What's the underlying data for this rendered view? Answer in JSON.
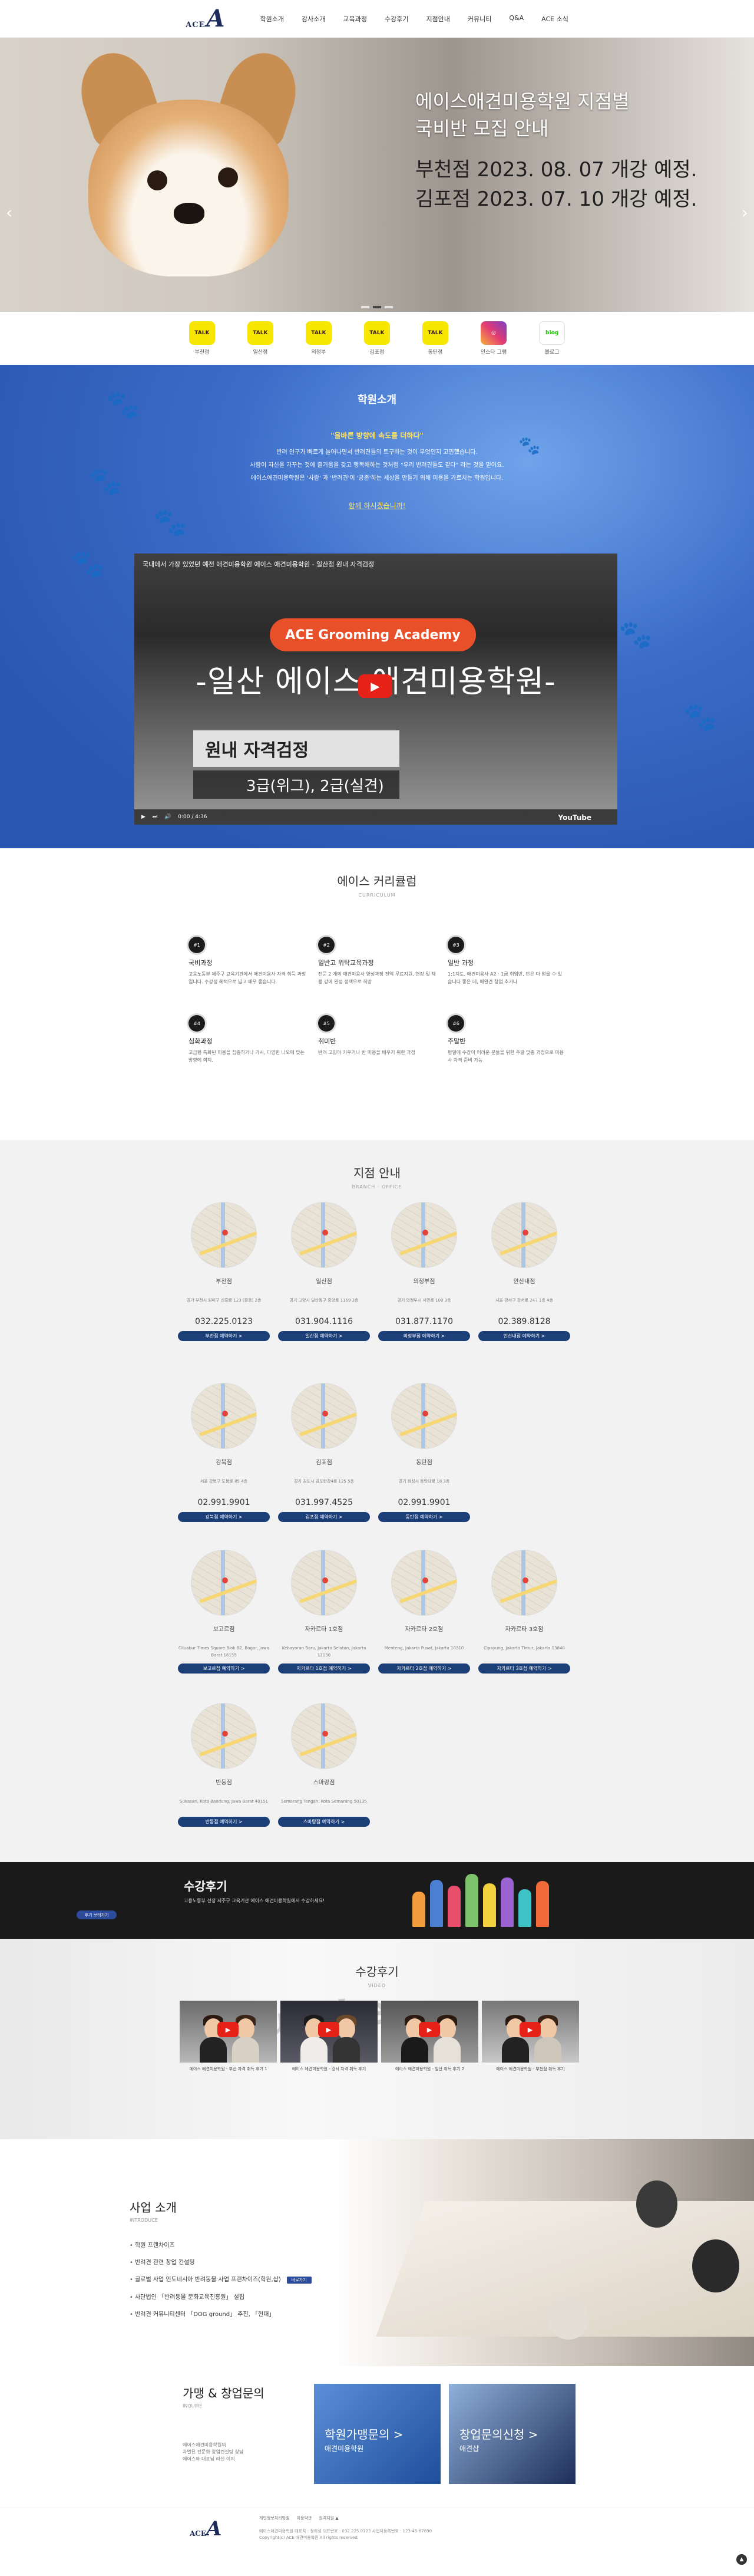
{
  "header": {
    "logo_small": "ACE",
    "logo_big": "A",
    "nav": [
      "학원소개",
      "강사소개",
      "교육과정",
      "수강후기",
      "지점안내",
      "커뮤니티",
      "Q&A",
      "ACE 소식"
    ]
  },
  "hero": {
    "line1": "에이스애견미용학원 지점별",
    "line2": "국비반 모집 안내",
    "line3": "부천점 2023. 08. 07 개강 예정.",
    "line4": "김포점 2023. 07. 10 개강 예정.",
    "prev": "‹",
    "next": "›"
  },
  "sns": [
    {
      "icon": "talk-icon",
      "badge": "TALK",
      "label": "부천점"
    },
    {
      "icon": "talk-icon",
      "badge": "TALK",
      "label": "일산점"
    },
    {
      "icon": "talk-icon",
      "badge": "TALK",
      "label": "의정부"
    },
    {
      "icon": "talk-icon",
      "badge": "TALK",
      "label": "김포점"
    },
    {
      "icon": "talk-icon",
      "badge": "TALK",
      "label": "동탄점"
    },
    {
      "icon": "instagram-icon",
      "badge": "◎",
      "label": "인스타 그램"
    },
    {
      "icon": "blog-icon",
      "badge": "blog",
      "label": "블로그"
    }
  ],
  "intro": {
    "title": "학원소개",
    "highlight": "\"올바른 방향에 속도를 더하다\"",
    "p1": "반려 인구가 빠르게 늘어나면서 반려견들의 트구하는 것이 무엇인지 고민했습니다.",
    "p2": "사람이 자신을 가꾸는 것에 즐거움을 갖고 행복해하는 것처럼 \"우리 반려견들도 같다\" 라는 것을 믿어요.",
    "p3": "에이스애견미용학원은 '사람' 과 '반려견'이 '공존'하는 세상을 만들기 위해 미용을 가르치는 학원입니다.",
    "link": "함께 하시겠습니까!",
    "video": {
      "title": "국내에서 가장 있었던 예전 애견미용학원 에이스 애견미용학원 - 일산점 원내 자격검정",
      "pill": "ACE Grooming Academy",
      "big": "-일산 에이스 애견미용학원-",
      "sub1": "원내 자격검정",
      "sub2": "3급(위그), 2급(실견)",
      "time": "0:00 / 4:36",
      "yt": "YouTube"
    }
  },
  "curriculum": {
    "title": "에이스 커리큘럼",
    "sub": "CURRICULUM",
    "items": [
      {
        "no": "#1",
        "title": "국비과정",
        "desc": "고용노동부 제주구 교육기관에서 애견미용사 자격 취득 과정입니다. 수강생 혜택으로 넘고 매우 좋습니다."
      },
      {
        "no": "#2",
        "title": "일반고 위탁교육과정",
        "desc": "전문 2 개의 애견미용사 양성과정 전액 무료지원, 현장 및 채용 강에 완성 정책으로 희망"
      },
      {
        "no": "#3",
        "title": "일반 과정",
        "desc": "1:1지도, 애견미용사 A2 · 1급 취업반, 반은 다 얻을 수 있습니다 좋은 데, 애완견 창업 추가나"
      },
      {
        "no": "#4",
        "title": "심화과정",
        "desc": "고급형 특화된 미용을 집중하거나 가시, 다양한 나오에 맞는 방향에 의지."
      },
      {
        "no": "#5",
        "title": "취미반",
        "desc": "반려 고양이 키우거나 반 미용을 배우기 위한 과정"
      },
      {
        "no": "#6",
        "title": "주말반",
        "desc": "평일에 수강이 어려운 분들을 위한 주말 맞춤 과정으로 미용사 자격 준비 가능"
      }
    ]
  },
  "branch": {
    "title": "지점 안내",
    "sub": "BRANCH · OFFICE",
    "items": [
      {
        "name": "부천점",
        "addr": "경기 부천시 원미구 신흥로 123 (중동) 2층",
        "tel": "032.225.0123",
        "btn": "부천점 예약하기 >"
      },
      {
        "name": "일산점",
        "addr": "경기 고양시 일산동구 중앙로 1169 3층",
        "tel": "031.904.1116",
        "btn": "일산점 예약하기 >"
      },
      {
        "name": "의정부점",
        "addr": "경기 의정부시 시민로 100 3층",
        "tel": "031.877.1170",
        "btn": "의정부점 예약하기 >"
      },
      {
        "name": "안산내점",
        "addr": "서울 강서구 강서로 247 1층 4층",
        "tel": "02.389.8128",
        "btn": "안산내점 예약하기 >"
      },
      {
        "name": "강북점",
        "addr": "서울 강북구 도봉로 85 4층",
        "tel": "02.991.9901",
        "btn": "강북점 예약하기 >"
      },
      {
        "name": "김포점",
        "addr": "경기 김포시 김포한강4로 125 5층",
        "tel": "031.997.4525",
        "btn": "김포점 예약하기 >"
      },
      {
        "name": "동탄점",
        "addr": "경기 화성시 동탄대로 18 3층",
        "tel": "02.991.9901",
        "btn": "동탄점 예약하기 >"
      },
      {
        "name": "",
        "addr": "",
        "tel": "",
        "btn": ""
      },
      {
        "name": "보고르점",
        "addr": "Ciluabur Times Square Blok B2, Bogor, Jawa Barat 16155",
        "tel": "",
        "btn": "보고르점 예약하기 >"
      },
      {
        "name": "자카르타 1호점",
        "addr": "Kebayoran Baru, Jakarta Selatan, Jakarta 12130",
        "tel": "",
        "btn": "자카르타 1호점 예약하기 >"
      },
      {
        "name": "자카르타 2호점",
        "addr": "Menteng, Jakarta Pusat, Jakarta 10310",
        "tel": "",
        "btn": "자카르타 2호점 예약하기 >"
      },
      {
        "name": "자카르타 3호점",
        "addr": "Cipayung, Jakarta Timur, Jakarta 13840",
        "tel": "",
        "btn": "자카르타 3호점 예약하기 >"
      },
      {
        "name": "반둥점",
        "addr": "Sukasari, Kota Bandung, Jawa Barat 40151",
        "tel": "",
        "btn": "반둥점 예약하기 >"
      },
      {
        "name": "스마랑점",
        "addr": "Semarang Tengah, Kota Semarang 50135",
        "tel": "",
        "btn": "스마랑점 예약하기 >"
      }
    ]
  },
  "review": {
    "title": "수강후기",
    "desc": "고용노동부 선정 제주구 교육기관 에이스 애견미용학원에서 수강하세요!",
    "btn": "후기 보러가기"
  },
  "video_review": {
    "title": "수강후기",
    "sub": "VIDEO",
    "bg": "YouTube",
    "items": [
      "에이스 애견미용학원 - 부산 자격 취득 후기 1",
      "에이스 애견미용학원 - 강서 자격 취득 후기",
      "에이스 애견미용학원 - 일산 취득 후기 2",
      "에이스 애견미용학원 - 부천점 취득 후기"
    ]
  },
  "business": {
    "title": "사업 소개",
    "sub": "INTRODUCE",
    "items": [
      "학원 프랜차이즈",
      "반려견 관련 창업 컨설팅",
      "글로벌 사업 인도네시아 반려동물 사업 프랜차이즈(학원,샵)",
      "사단법인 「반려동물 문화교육진흥원」 설립",
      "반려견 커뮤니티센터 「DOG ground」 추진, 「현대」"
    ],
    "badge": "바로가기"
  },
  "inquiry": {
    "title": "가맹 & 창업문의",
    "sub": "INQUIRE",
    "p": [
      "에이스애견미용학원의",
      "차별된 전문화 창업컨설팅 상담",
      "에이스와 대표님 라신 이지"
    ],
    "card1_a": "학원가맹문의 >",
    "card1_b": "애견미용학원",
    "card2_a": "창업문의신청 >",
    "card2_b": "애견샵"
  },
  "footer": {
    "logo_small": "ACE",
    "logo_big": "A",
    "links": [
      "개인정보처리방침",
      "이용약관",
      "원격지원 ▲"
    ],
    "info": [
      "에이스애견미용학원 대표자 : 정희성   대표번호 : 032.225.0123   사업자등록번호 : 123-45-67890",
      "Copyright(c) ACE 애견미용학원 All rights reserved."
    ],
    "top": "▲"
  },
  "colors": {
    "nav_blue": "#1d3f78",
    "accent": "#e8502a",
    "kakao": "#f7e600"
  }
}
